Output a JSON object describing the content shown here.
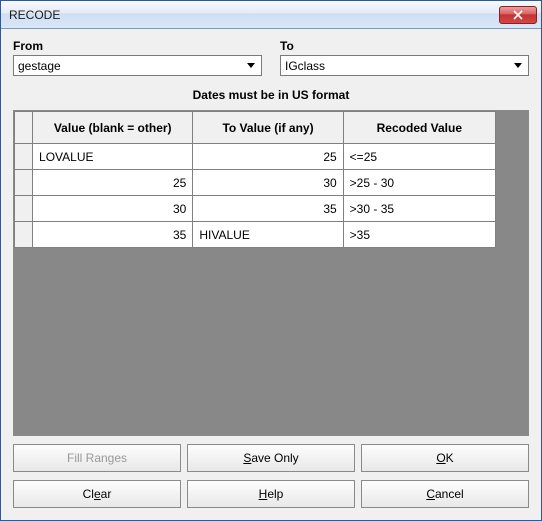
{
  "window": {
    "title": "RECODE"
  },
  "fields": {
    "from": {
      "label": "From",
      "value": "gestage"
    },
    "to": {
      "label": "To",
      "value": "IGclass"
    }
  },
  "note": "Dates must be in US format",
  "grid": {
    "headers": {
      "value": "Value (blank = other)",
      "to_value": "To Value (if any)",
      "recoded": "Recoded Value"
    },
    "rows": [
      {
        "value": "LOVALUE",
        "value_align": "txt",
        "to_value": "25",
        "to_align": "num",
        "recoded": "<=25"
      },
      {
        "value": "25",
        "value_align": "num",
        "to_value": "30",
        "to_align": "num",
        "recoded": ">25 - 30"
      },
      {
        "value": "30",
        "value_align": "num",
        "to_value": "35",
        "to_align": "num",
        "recoded": ">30 - 35"
      },
      {
        "value": "35",
        "value_align": "num",
        "to_value": "HIVALUE",
        "to_align": "txt",
        "recoded": ">35"
      }
    ]
  },
  "buttons": {
    "fill_ranges": "Fill Ranges",
    "save_only": "Save Only",
    "ok": "OK",
    "clear": "Clear",
    "help": "Help",
    "cancel": "Cancel"
  },
  "mnemonics": {
    "save_only": "S",
    "ok": "O",
    "clear": "e",
    "help": "H",
    "cancel": "C"
  }
}
